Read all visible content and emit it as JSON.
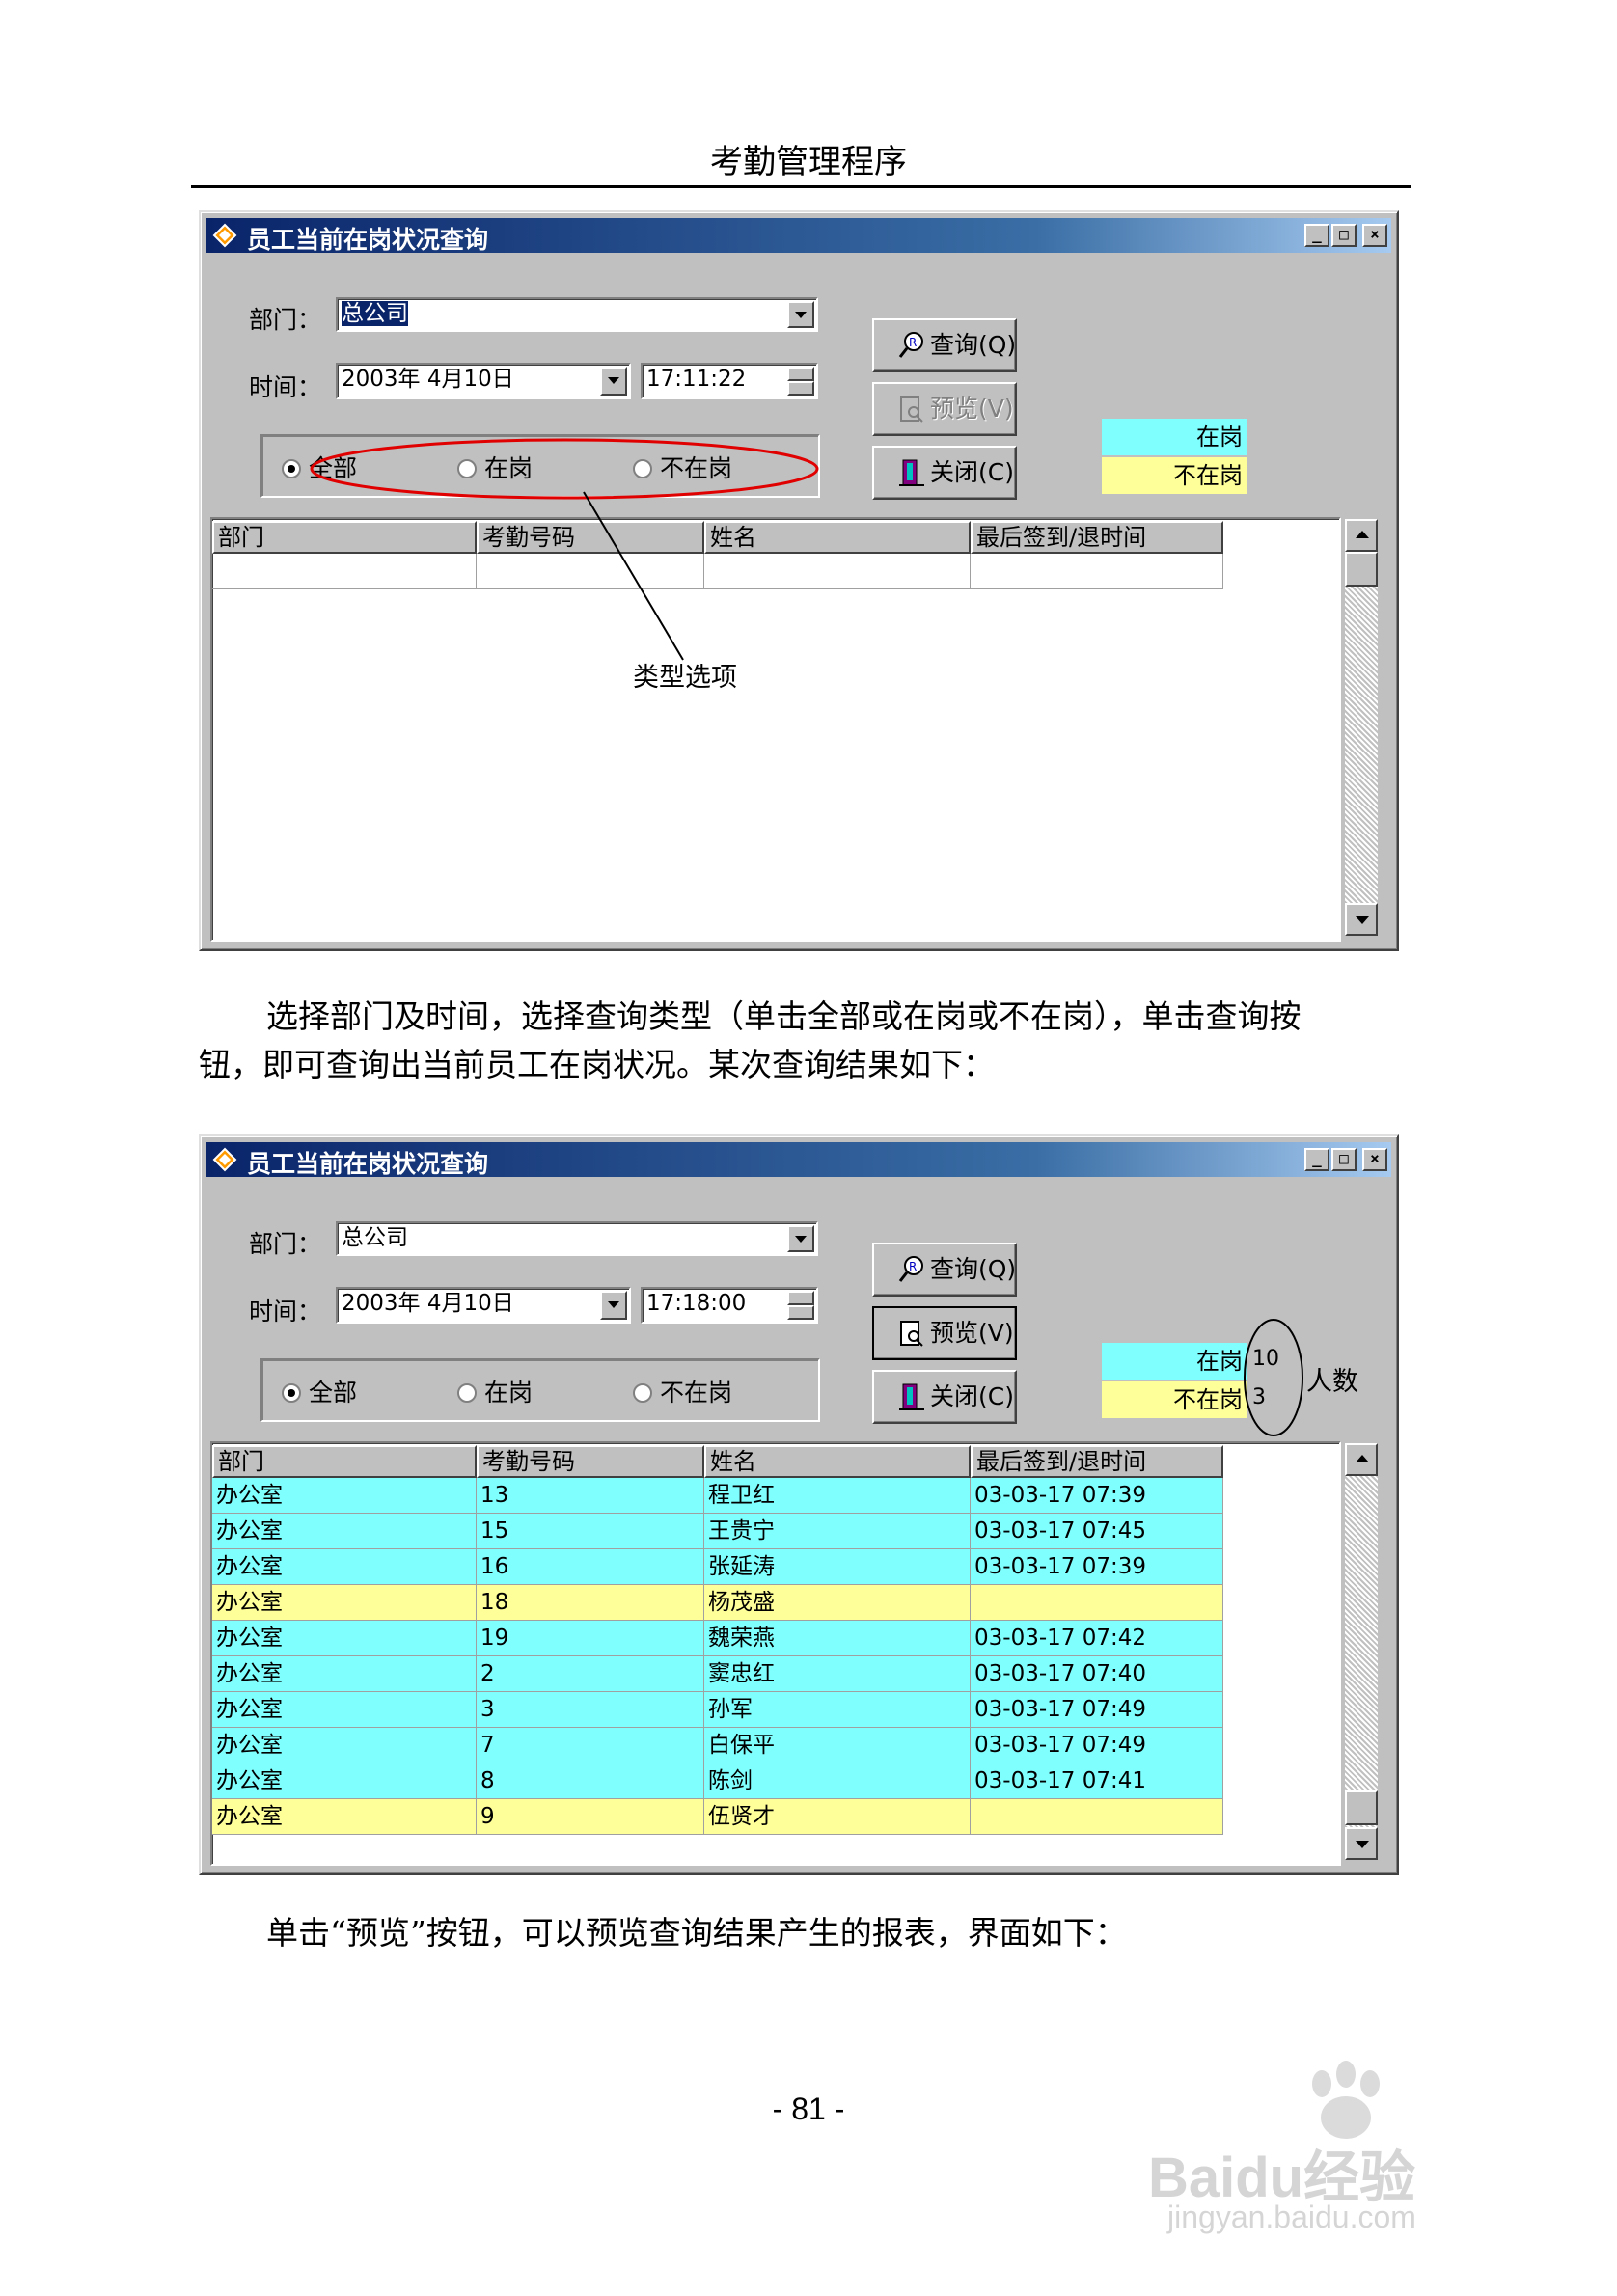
{
  "page": {
    "header": "考勤管理程序",
    "paragraph1_line1": "选择部门及时间，选择查询类型（单击全部或在岗或不在岗），单击查询按",
    "paragraph1_line2": "钮，即可查询出当前员工在岗状况。某次查询结果如下：",
    "paragraph2": "单击“预览”按钮，可以预览查询结果产生的报表，界面如下：",
    "page_number": "- 81 -"
  },
  "window1": {
    "title": "员工当前在岗状况查询",
    "dept_label": "部门：",
    "dept_value": "总公司",
    "time_label": "时间：",
    "date_value": "2003年  4月10日",
    "time_value": "17:11:22",
    "radios": [
      "全部",
      "在岗",
      "不在岗"
    ],
    "selected_radio": "全部",
    "buttons": {
      "query": "查询(Q)",
      "preview": "预览(V)",
      "close": "关闭(C)"
    },
    "preview_disabled": true,
    "legend": {
      "on_duty": "在岗",
      "off_duty": "不在岗",
      "on_color": "#80ffff",
      "off_color": "#ffff99"
    },
    "columns": [
      "部门",
      "考勤号码",
      "姓名",
      "最后签到/退时间"
    ],
    "annotation": "类型选项"
  },
  "window2": {
    "title": "员工当前在岗状况查询",
    "dept_label": "部门：",
    "dept_value": "总公司",
    "time_label": "时间：",
    "date_value": "2003年  4月10日",
    "time_value": "17:18:00",
    "radios": [
      "全部",
      "在岗",
      "不在岗"
    ],
    "selected_radio": "全部",
    "buttons": {
      "query": "查询(Q)",
      "preview": "预览(V)",
      "close": "关闭(C)"
    },
    "legend": {
      "on_duty": "在岗",
      "off_duty": "不在岗",
      "on_count": "10",
      "off_count": "3"
    },
    "annotation": "人数",
    "columns": [
      "部门",
      "考勤号码",
      "姓名",
      "最后签到/退时间"
    ],
    "rows": [
      {
        "dept": "办公室",
        "id": "13",
        "name": "程卫红",
        "time": "03-03-17 07:39",
        "status": "on"
      },
      {
        "dept": "办公室",
        "id": "15",
        "name": "王贵宁",
        "time": "03-03-17 07:45",
        "status": "on"
      },
      {
        "dept": "办公室",
        "id": "16",
        "name": "张延涛",
        "time": "03-03-17 07:39",
        "status": "on"
      },
      {
        "dept": "办公室",
        "id": "18",
        "name": "杨茂盛",
        "time": "",
        "status": "off"
      },
      {
        "dept": "办公室",
        "id": "19",
        "name": "魏荣燕",
        "time": "03-03-17 07:42",
        "status": "on"
      },
      {
        "dept": "办公室",
        "id": "2",
        "name": "窦忠红",
        "time": "03-03-17 07:40",
        "status": "on"
      },
      {
        "dept": "办公室",
        "id": "3",
        "name": "孙军",
        "time": "03-03-17 07:49",
        "status": "on"
      },
      {
        "dept": "办公室",
        "id": "7",
        "name": "白保平",
        "time": "03-03-17 07:49",
        "status": "on"
      },
      {
        "dept": "办公室",
        "id": "8",
        "name": "陈剑",
        "time": "03-03-17 07:41",
        "status": "on"
      },
      {
        "dept": "办公室",
        "id": "9",
        "name": "伍贤才",
        "time": "",
        "status": "off"
      }
    ]
  },
  "watermark": {
    "brand": "Baidu经验",
    "url": "jingyan.baidu.com"
  }
}
